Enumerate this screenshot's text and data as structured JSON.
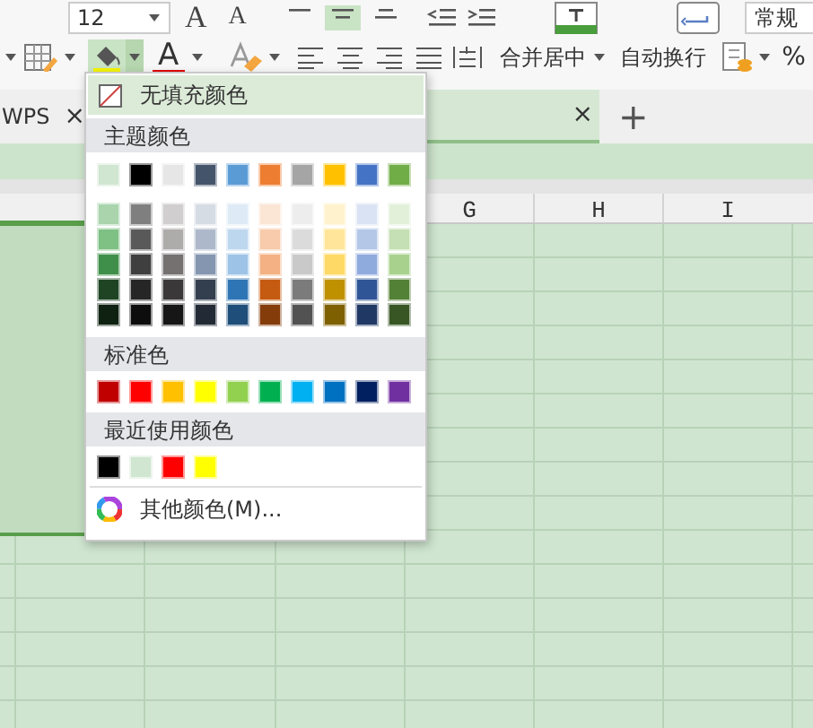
{
  "ribbon": {
    "font_size": "12",
    "font_grow": "A",
    "font_shrink": "A",
    "font_color": "A",
    "merge_center": "合并居中",
    "wrap_text": "自动换行",
    "number_format": "常规",
    "percent": "%",
    "fill_selected": true
  },
  "tabs": [
    {
      "label": "WPS",
      "close": "×",
      "selected": false
    },
    {
      "close": "×",
      "selected": true
    }
  ],
  "new_tab": "+",
  "columns": [
    "G",
    "H",
    "I"
  ],
  "fill_menu": {
    "no_fill": {
      "label": "无填充颜色",
      "highlighted": true
    },
    "theme_title": "主题颜色",
    "theme_colors": [
      {
        "color": "#d0e6d1"
      },
      {
        "color": "#000000"
      },
      {
        "color": "#e7e6e6"
      },
      {
        "color": "#44546a"
      },
      {
        "color": "#5b9bd5"
      },
      {
        "color": "#ed7d31"
      },
      {
        "color": "#a5a5a5"
      },
      {
        "color": "#ffc000"
      },
      {
        "color": "#4472c4"
      },
      {
        "color": "#70ad47"
      }
    ],
    "shade_rows": [
      {
        "swatches": [
          {
            "color": "#a9d4ac"
          },
          {
            "color": "#7f7f7f"
          },
          {
            "color": "#d0cece"
          },
          {
            "color": "#d6dce4"
          },
          {
            "color": "#deebf6"
          },
          {
            "color": "#fbe5d5"
          },
          {
            "color": "#ededed"
          },
          {
            "color": "#fff2cc"
          },
          {
            "color": "#dae3f3"
          },
          {
            "color": "#e2f0d9"
          }
        ]
      },
      {
        "swatches": [
          {
            "color": "#7fc084"
          },
          {
            "color": "#595959"
          },
          {
            "color": "#aeabab"
          },
          {
            "color": "#adb9ca"
          },
          {
            "color": "#bdd7ee"
          },
          {
            "color": "#f7cbac"
          },
          {
            "color": "#dbdbdb"
          },
          {
            "color": "#fee599"
          },
          {
            "color": "#b4c7e7"
          },
          {
            "color": "#c5e0b4"
          }
        ]
      },
      {
        "swatches": [
          {
            "color": "#3f8f4a"
          },
          {
            "color": "#3f3f3f"
          },
          {
            "color": "#757171"
          },
          {
            "color": "#8496b0"
          },
          {
            "color": "#9dc3e6"
          },
          {
            "color": "#f4b183"
          },
          {
            "color": "#c9c9c9"
          },
          {
            "color": "#ffd965"
          },
          {
            "color": "#8faadc"
          },
          {
            "color": "#a9d18e"
          }
        ]
      },
      {
        "swatches": [
          {
            "color": "#1e4424"
          },
          {
            "color": "#262626"
          },
          {
            "color": "#3a3838"
          },
          {
            "color": "#333f4f"
          },
          {
            "color": "#2e75b5"
          },
          {
            "color": "#c55a11"
          },
          {
            "color": "#7b7b7b"
          },
          {
            "color": "#bf9000"
          },
          {
            "color": "#2f5597"
          },
          {
            "color": "#538135"
          }
        ]
      },
      {
        "swatches": [
          {
            "color": "#0f2212"
          },
          {
            "color": "#0d0d0d"
          },
          {
            "color": "#161616"
          },
          {
            "color": "#222a35"
          },
          {
            "color": "#1e4e79"
          },
          {
            "color": "#843c0b"
          },
          {
            "color": "#525252"
          },
          {
            "color": "#7f6000"
          },
          {
            "color": "#203864"
          },
          {
            "color": "#375623"
          }
        ]
      }
    ],
    "standard_title": "标准色",
    "standard_colors": [
      {
        "color": "#c00000"
      },
      {
        "color": "#ff0000"
      },
      {
        "color": "#ffc000"
      },
      {
        "color": "#ffff00"
      },
      {
        "color": "#92d050"
      },
      {
        "color": "#00b050"
      },
      {
        "color": "#00b0f0"
      },
      {
        "color": "#0070c0"
      },
      {
        "color": "#002060"
      },
      {
        "color": "#7030a0"
      }
    ],
    "recent_title": "最近使用颜色",
    "recent_colors": [
      {
        "color": "#000000"
      },
      {
        "color": "#d0e6d1"
      },
      {
        "color": "#ff0000"
      },
      {
        "color": "#ffff00"
      }
    ],
    "more_colors": "其他颜色(M)..."
  }
}
